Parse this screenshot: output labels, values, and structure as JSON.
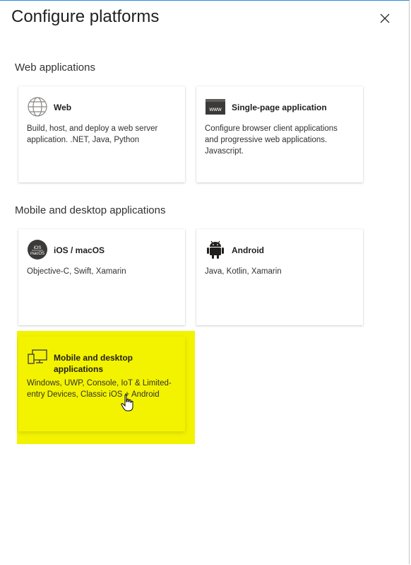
{
  "panel": {
    "title": "Configure platforms"
  },
  "sections": [
    {
      "title": "Web applications"
    },
    {
      "title": "Mobile and desktop applications"
    }
  ],
  "cards": {
    "web": {
      "name": "Web",
      "desc": "Build, host, and deploy a web server application. .NET, Java, Python",
      "icon": "globe-icon"
    },
    "spa": {
      "name": "Single-page application",
      "desc": "Configure browser client applications and progressive web applications. Javascript.",
      "icon": "browser-window-icon",
      "icon_text": "www"
    },
    "ios": {
      "name": "iOS / macOS",
      "desc": "Objective-C, Swift, Xamarin",
      "icon": "ios-macos-icon",
      "icon_text_1": "iOS",
      "icon_text_2": "macOS"
    },
    "android": {
      "name": "Android",
      "desc": "Java, Kotlin, Xamarin",
      "icon": "android-icon"
    },
    "desktop": {
      "name": "Mobile and desktop applications",
      "desc": "Windows, UWP, Console, IoT & Limited-entry Devices, Classic iOS + Android",
      "icon": "desktop-devices-icon"
    }
  },
  "highlight_color": "#f3f300"
}
